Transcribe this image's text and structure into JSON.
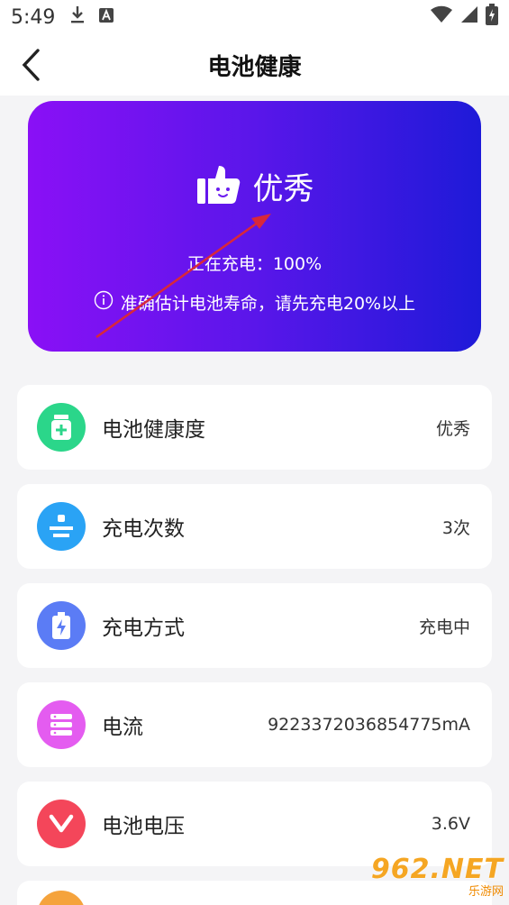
{
  "status_bar": {
    "time": "5:49"
  },
  "app_bar": {
    "title": "电池健康"
  },
  "hero": {
    "grade": "优秀",
    "charging_text": "正在充电：100%",
    "tip": "准确估计电池寿命，请先充电20%以上",
    "gradient": [
      "#8a10f6",
      "#1e1ad8"
    ]
  },
  "items": [
    {
      "label": "电池健康度",
      "value": "优秀",
      "icon": "medicine-bottle-icon",
      "color": "#2bd68a"
    },
    {
      "label": "充电次数",
      "value": "3次",
      "icon": "charge-count-icon",
      "color": "#2aa3f5"
    },
    {
      "label": "充电方式",
      "value": "充电中",
      "icon": "battery-bolt-icon",
      "color": "#5b7cf5"
    },
    {
      "label": "电流",
      "value": "9223372036854775mA",
      "icon": "server-stack-icon",
      "color": "#e45cf0"
    },
    {
      "label": "电池电压",
      "value": "3.6V",
      "icon": "chevron-v-icon",
      "color": "#f4465a"
    }
  ],
  "watermark": {
    "main": "962.NET",
    "sub": "乐游网"
  }
}
